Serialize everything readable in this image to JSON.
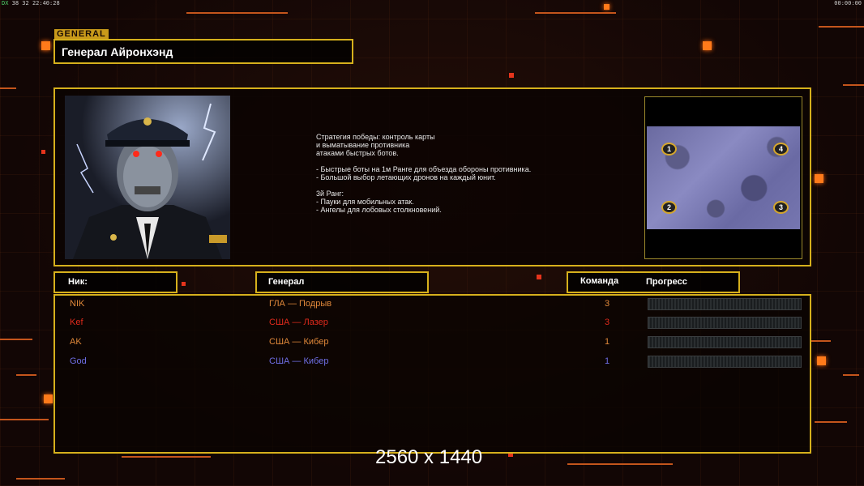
{
  "hud": {
    "top_left_status": "38 32",
    "top_left_time": "22:40:28",
    "top_right_time": "00:00:00"
  },
  "header": {
    "tag": "GENERAL",
    "title": "Генерал Айронхэнд"
  },
  "description": {
    "lines_1": [
      "Стратегия победы: контроль карты",
      "и выматывание противника",
      "атаками быстрых ботов."
    ],
    "lines_2": [
      "- Быстрые боты на 1м Ранге для объезда обороны противника.",
      "- Большой выбор летающих дронов на каждый юнит."
    ],
    "lines_3": [
      "3й Ранг:",
      "- Пауки для мобильных атак.",
      "- Ангелы для лобовых столкновений."
    ]
  },
  "map": {
    "spawns": [
      "1",
      "4",
      "2",
      "3"
    ]
  },
  "columns": {
    "nick": "Ник:",
    "general": "Генерал",
    "team": "Команда",
    "progress": "Прогресс"
  },
  "players": [
    {
      "nick": "NIK",
      "general": "ГЛА — Подрыв",
      "team": "3",
      "color": "#e0883a",
      "progress": 0
    },
    {
      "nick": "Kef",
      "general": "США — Лазер",
      "team": "3",
      "color": "#e02a1c",
      "progress": 0
    },
    {
      "nick": "AK",
      "general": "США — Кибер",
      "team": "1",
      "color": "#e0883a",
      "progress": 0
    },
    {
      "nick": "God",
      "general": "США — Кибер",
      "team": "1",
      "color": "#6f6fe6",
      "progress": 0
    }
  ],
  "resolution": "2560 x 1440"
}
